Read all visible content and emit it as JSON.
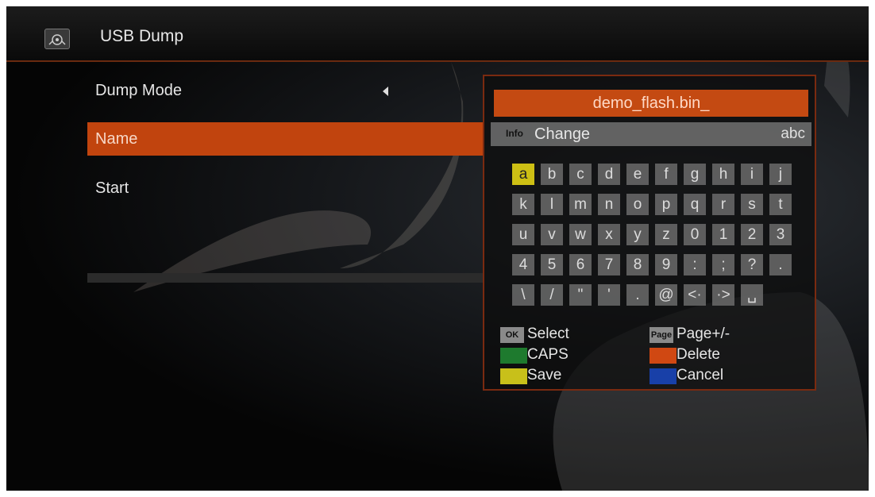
{
  "title": "USB Dump",
  "menu": {
    "items": [
      {
        "label": "Dump Mode"
      },
      {
        "label": "Name"
      },
      {
        "label": "Start"
      }
    ],
    "selected_index": 1
  },
  "dialog": {
    "input_value": "demo_flash.bin_",
    "info_badge": "Info",
    "info_action": "Change",
    "input_mode": "abc",
    "keys": [
      [
        "a",
        "b",
        "c",
        "d",
        "e",
        "f",
        "g",
        "h",
        "i",
        "j"
      ],
      [
        "k",
        "l",
        "m",
        "n",
        "o",
        "p",
        "q",
        "r",
        "s",
        "t"
      ],
      [
        "u",
        "v",
        "w",
        "x",
        "y",
        "z",
        "0",
        "1",
        "2",
        "3"
      ],
      [
        "4",
        "5",
        "6",
        "7",
        "8",
        "9",
        ":",
        ";",
        "?",
        "."
      ],
      [
        "\\",
        "/",
        "\"",
        "'",
        ".",
        "@",
        "<·",
        "·>",
        "␣"
      ]
    ],
    "active_key": "a",
    "help": {
      "ok_tag": "OK",
      "select": "Select",
      "page_tag": "Page",
      "page": "Page+/-",
      "caps": "CAPS",
      "delete": "Delete",
      "save": "Save",
      "cancel": "Cancel"
    }
  },
  "colors": {
    "accent": "#c1440e",
    "green": "#1e7a2e",
    "red": "#d04812",
    "yellow": "#c8c01a",
    "blue": "#1840a8"
  }
}
